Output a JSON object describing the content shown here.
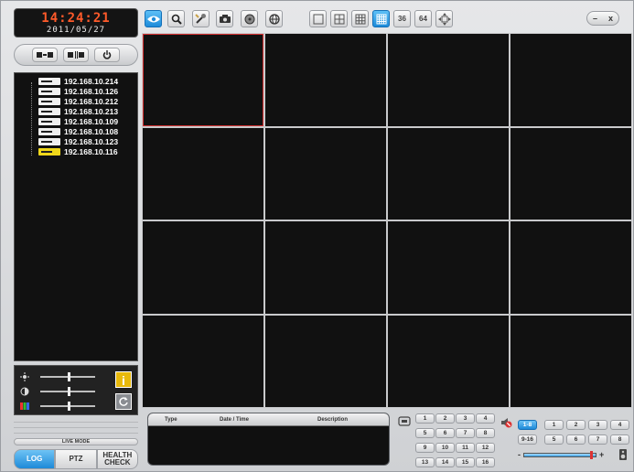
{
  "clock": {
    "time": "14:24:21",
    "date": "2011/05/27"
  },
  "devices": [
    {
      "ip": "192.168.10.214",
      "selected": false
    },
    {
      "ip": "192.168.10.126",
      "selected": false
    },
    {
      "ip": "192.168.10.212",
      "selected": false
    },
    {
      "ip": "192.168.10.213",
      "selected": false
    },
    {
      "ip": "192.168.10.109",
      "selected": false
    },
    {
      "ip": "192.168.10.108",
      "selected": false
    },
    {
      "ip": "192.168.10.123",
      "selected": false
    },
    {
      "ip": "192.168.10.116",
      "selected": true
    }
  ],
  "adjust": {
    "brightness": 0.5,
    "contrast": 0.5,
    "color": 0.5
  },
  "info_label": "i",
  "live_mode_label": "LIVE MODE",
  "mode_tabs": [
    {
      "label": "LOG",
      "active": true
    },
    {
      "label": "PTZ",
      "active": false
    },
    {
      "label": "HEALTH CHECK",
      "active": false
    }
  ],
  "window_controls": {
    "minimize": "–",
    "close": "x"
  },
  "toolbar": {
    "layout_36": "36",
    "layout_64": "64"
  },
  "log": {
    "columns": [
      "Type",
      "Date / Time",
      "Description"
    ]
  },
  "channels": [
    "1",
    "2",
    "3",
    "4",
    "5",
    "6",
    "7",
    "8",
    "9",
    "10",
    "11",
    "12",
    "13",
    "14",
    "15",
    "16"
  ],
  "group_buttons": [
    "1-8",
    "9-16"
  ],
  "group_active": "1-8",
  "page_channels": [
    "1",
    "2",
    "3",
    "4",
    "5",
    "6",
    "7",
    "8"
  ],
  "volume": {
    "minus": "-",
    "plus": "+",
    "level": 0.9
  },
  "colors": {
    "accent": "#1e8ad8",
    "selected_device": "#f0d81a",
    "selection_border": "#d23030"
  }
}
